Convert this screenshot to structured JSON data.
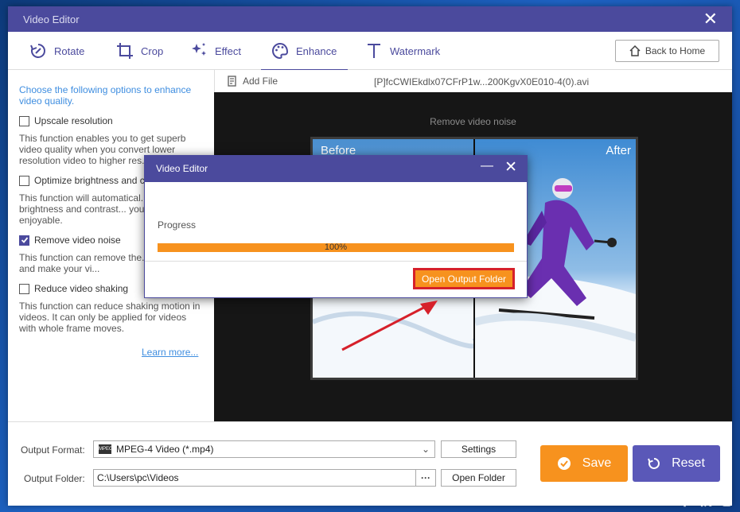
{
  "window": {
    "title": "Video Editor"
  },
  "toolbar": {
    "tabs": [
      {
        "label": "Rotate",
        "icon": "rotate-icon"
      },
      {
        "label": "Crop",
        "icon": "crop-icon"
      },
      {
        "label": "Effect",
        "icon": "effect-icon"
      },
      {
        "label": "Enhance",
        "icon": "enhance-icon",
        "active": true
      },
      {
        "label": "Watermark",
        "icon": "watermark-icon"
      }
    ],
    "back_home": "Back to Home"
  },
  "enhance": {
    "intro": "Choose the following options to enhance video quality.",
    "options": [
      {
        "label": "Upscale resolution",
        "checked": false,
        "desc": "This function enables you to get superb video quality when you convert lower resolution video to higher res..."
      },
      {
        "label": "Optimize brightness and c...",
        "checked": false,
        "desc": "This function will automatical... the brightness and contrast... your video more enjoyable."
      },
      {
        "label": "Remove video noise",
        "checked": true,
        "desc": "This function can remove the... video noise and make your vi..."
      },
      {
        "label": "Reduce video shaking",
        "checked": false,
        "desc": "This function can reduce shaking motion in videos. It can only be applied for videos with whole frame moves."
      }
    ],
    "learn_more": "Learn more..."
  },
  "file": {
    "add_file": "Add File",
    "name": "[P]fcCWIEkdlx07CFrP1w...200KgvX0E010-4(0).avi"
  },
  "preview": {
    "caption": "Remove video noise",
    "before": "Before",
    "after": "After"
  },
  "output": {
    "format_label": "Output Format:",
    "format_value": "MPEG-4 Video (*.mp4)",
    "settings": "Settings",
    "folder_label": "Output Folder:",
    "folder_value": "C:\\Users\\pc\\Videos",
    "open_folder": "Open Folder",
    "save": "Save",
    "reset": "Reset"
  },
  "dialog": {
    "title": "Video Editor",
    "progress_label": "Progress",
    "progress_value": 100,
    "progress_text": "100%",
    "open_output": "Open Output Folder"
  },
  "colors": {
    "accent": "#4b4a9d",
    "orange": "#f7921e",
    "highlight": "#d6202a"
  }
}
